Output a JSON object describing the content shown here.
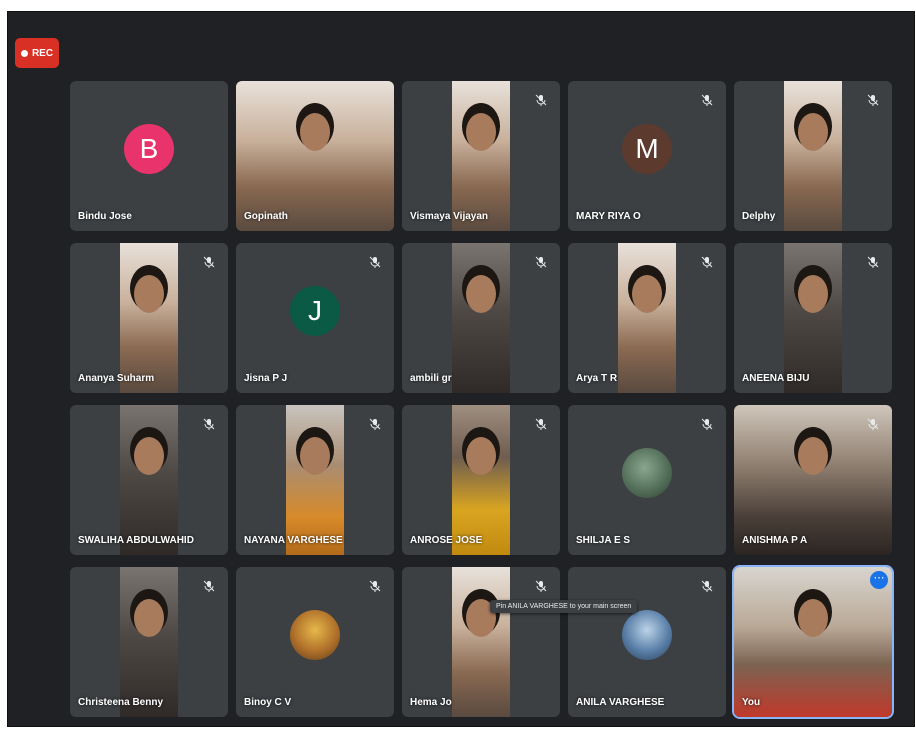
{
  "recording_badge": "REC",
  "tooltip": "Pin ANILA VARGHESE to your main screen",
  "participants": [
    {
      "name": "Bindu Jose",
      "avatar_letter": "B",
      "avatar_color": "#e8336d",
      "muted": false
    },
    {
      "name": "Gopinath",
      "video": true,
      "muted": false
    },
    {
      "name": "Vismaya Vijayan",
      "video": true,
      "muted": true
    },
    {
      "name": "MARY RIYA O",
      "avatar_letter": "M",
      "avatar_color": "#5d3a2e",
      "muted": true
    },
    {
      "name": "Delphy",
      "video": true,
      "muted": true
    },
    {
      "name": "Ananya Suharm",
      "video": true,
      "muted": true
    },
    {
      "name": "Jisna P J",
      "avatar_letter": "J",
      "avatar_color": "#0b5a45",
      "muted": true
    },
    {
      "name": "ambili gr",
      "video": true,
      "muted": true
    },
    {
      "name": "Arya T R",
      "video": true,
      "muted": true
    },
    {
      "name": "ANEENA BIJU",
      "video": true,
      "muted": true
    },
    {
      "name": "SWALIHA ABDULWAHID",
      "video": true,
      "muted": true
    },
    {
      "name": "NAYANA VARGHESE",
      "video": true,
      "muted": true
    },
    {
      "name": "ANROSE JOSE",
      "video": true,
      "muted": true
    },
    {
      "name": "SHILJA E S",
      "avatar_image": true,
      "muted": true
    },
    {
      "name": "ANISHMA P A",
      "video": true,
      "muted": true
    },
    {
      "name": "Christeena Benny",
      "video": true,
      "muted": true
    },
    {
      "name": "Binoy C V",
      "avatar_image": true,
      "muted": true
    },
    {
      "name": "Hema Jo",
      "video": true,
      "muted": true
    },
    {
      "name": "ANILA VARGHESE",
      "avatar_image": true,
      "muted": true
    },
    {
      "name": "You",
      "video": true,
      "self": true,
      "muted": false
    }
  ]
}
